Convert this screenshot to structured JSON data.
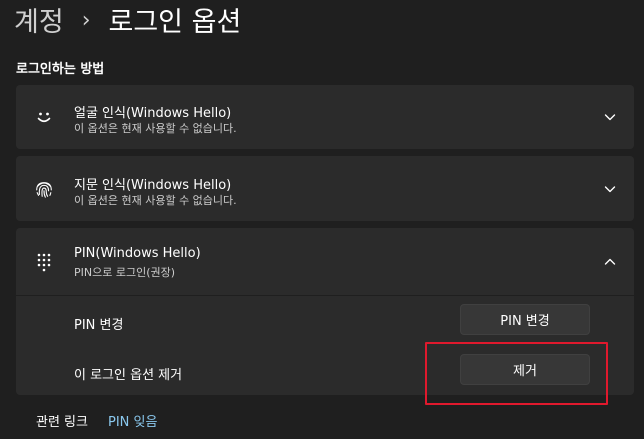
{
  "breadcrumb": {
    "parent": "계정",
    "separator": "›",
    "current": "로그인 옵션"
  },
  "section_title": "로그인하는 방법",
  "cards": {
    "face": {
      "icon": "smiley-face-icon",
      "title": "얼굴 인식(Windows Hello)",
      "subtitle": "이 옵션은 현재 사용할 수 없습니다.",
      "expanded": false
    },
    "fingerprint": {
      "icon": "fingerprint-icon",
      "title": "지문 인식(Windows Hello)",
      "subtitle": "이 옵션은 현재 사용할 수 없습니다.",
      "expanded": false
    },
    "pin": {
      "icon": "keypad-icon",
      "title": "PIN(Windows Hello)",
      "subtitle": "PIN으로 로그인(권장)",
      "expanded": true,
      "rows": {
        "change_label": "PIN 변경",
        "change_button": "PIN 변경",
        "remove_label": "이 로그인 옵션 제거",
        "remove_button": "제거"
      }
    }
  },
  "related": {
    "label": "관련 링크",
    "link": "PIN 잊음"
  },
  "colors": {
    "background": "#1f1f1f",
    "card": "#2b2b2b",
    "button": "#373737",
    "link": "#8ac8ee",
    "highlight": "#e0192d"
  }
}
